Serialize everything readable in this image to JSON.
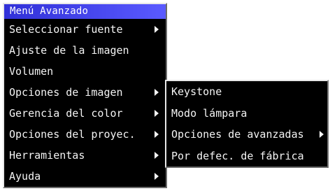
{
  "main_menu": {
    "title": "Menú Avanzado",
    "items": [
      {
        "label": "Seleccionar fuente",
        "has_submenu": true
      },
      {
        "label": "Ajuste de la imagen",
        "has_submenu": false
      },
      {
        "label": "Volumen",
        "has_submenu": false
      },
      {
        "label": "Opciones de imagen",
        "has_submenu": true
      },
      {
        "label": "Gerencia del color",
        "has_submenu": true
      },
      {
        "label": "Opciones del proyec.",
        "has_submenu": true
      },
      {
        "label": "Herramientas",
        "has_submenu": true
      },
      {
        "label": "Ayuda",
        "has_submenu": true
      }
    ]
  },
  "sub_menu": {
    "items": [
      {
        "label": "Keystone",
        "has_submenu": false
      },
      {
        "label": "Modo lámpara",
        "has_submenu": false
      },
      {
        "label": "Opciones de avanzadas",
        "has_submenu": true
      },
      {
        "label": "Por defec. de fábrica",
        "has_submenu": false
      }
    ]
  },
  "colors": {
    "menu_background": "#000000",
    "title_background": "#3030d8",
    "text": "#f4f4f4"
  },
  "icons": {
    "submenu_indicator": "triangle-right-icon"
  }
}
